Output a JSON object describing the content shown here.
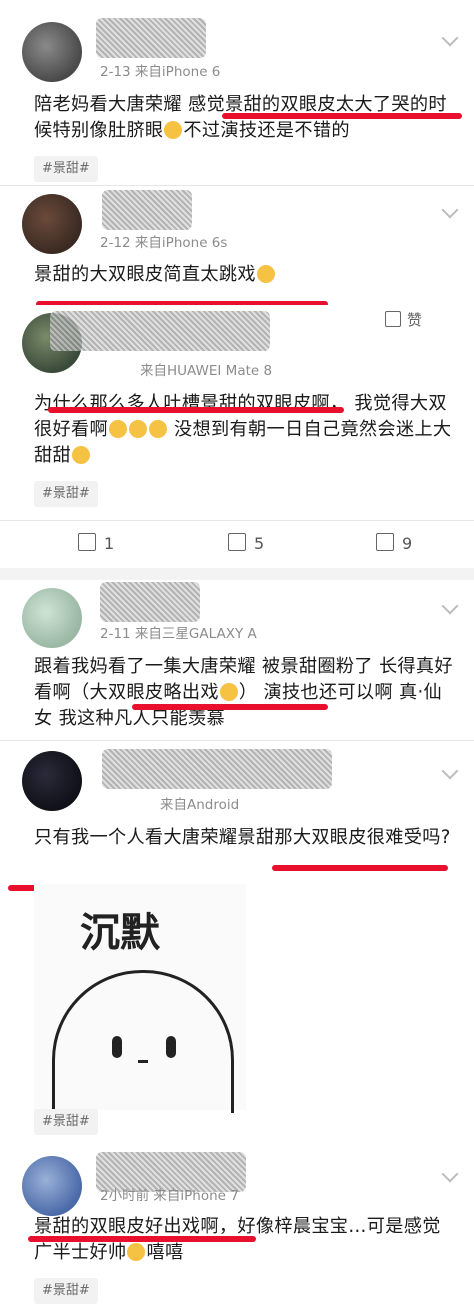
{
  "comments": [
    {
      "meta": "2-13  来自iPhone 6",
      "text": "陪老妈看大唐荣耀 感觉景甜的双眼皮太大了哭的时候特别像肚脐眼",
      "text_tail": "不过演技还是不错的",
      "tag": "#景甜#"
    },
    {
      "meta": "2-12  来自iPhone 6s",
      "text": "景甜的大双眼皮简直太跳戏",
      "like_label": "赞"
    },
    {
      "meta": "来自HUAWEI Mate 8",
      "text": "为什么那么多人吐槽景甜的双眼皮啊， 我觉得大双很好看啊",
      "text_tail": "  没想到有朝一日自己竟然会迷上大甜甜",
      "tag": "#景甜#",
      "actions": {
        "repost": "1",
        "comment": "5",
        "like": "9"
      }
    },
    {
      "meta": "2-11  来自三星GALAXY A",
      "text": "跟着我妈看了一集大唐荣耀 被景甜圈粉了 长得真好看啊（大双眼皮略出戏",
      "text_tail": "） 演技也还可以啊 真·仙女 我这种凡人只能羡慕"
    },
    {
      "meta": "来自Android",
      "text": "只有我一个人看大唐荣耀景甜那大双眼皮很难受吗?",
      "meme_text": "沉默",
      "tag": "#景甜#"
    },
    {
      "meta": "2小时前  来自iPhone 7",
      "text": "景甜的双眼皮好出戏啊，好像梓晨宝宝…可是感觉广半士好帅",
      "text_tail": "嘻嘻",
      "tag": "#景甜#"
    }
  ],
  "icons": [
    "chevron-down-icon",
    "repost-icon",
    "comment-icon",
    "thumbs-up-icon",
    "emoji-icon"
  ],
  "colors": {
    "highlight": "#e8102d",
    "tag_bg": "#f2f2f2",
    "meta": "#8c8c8c"
  }
}
